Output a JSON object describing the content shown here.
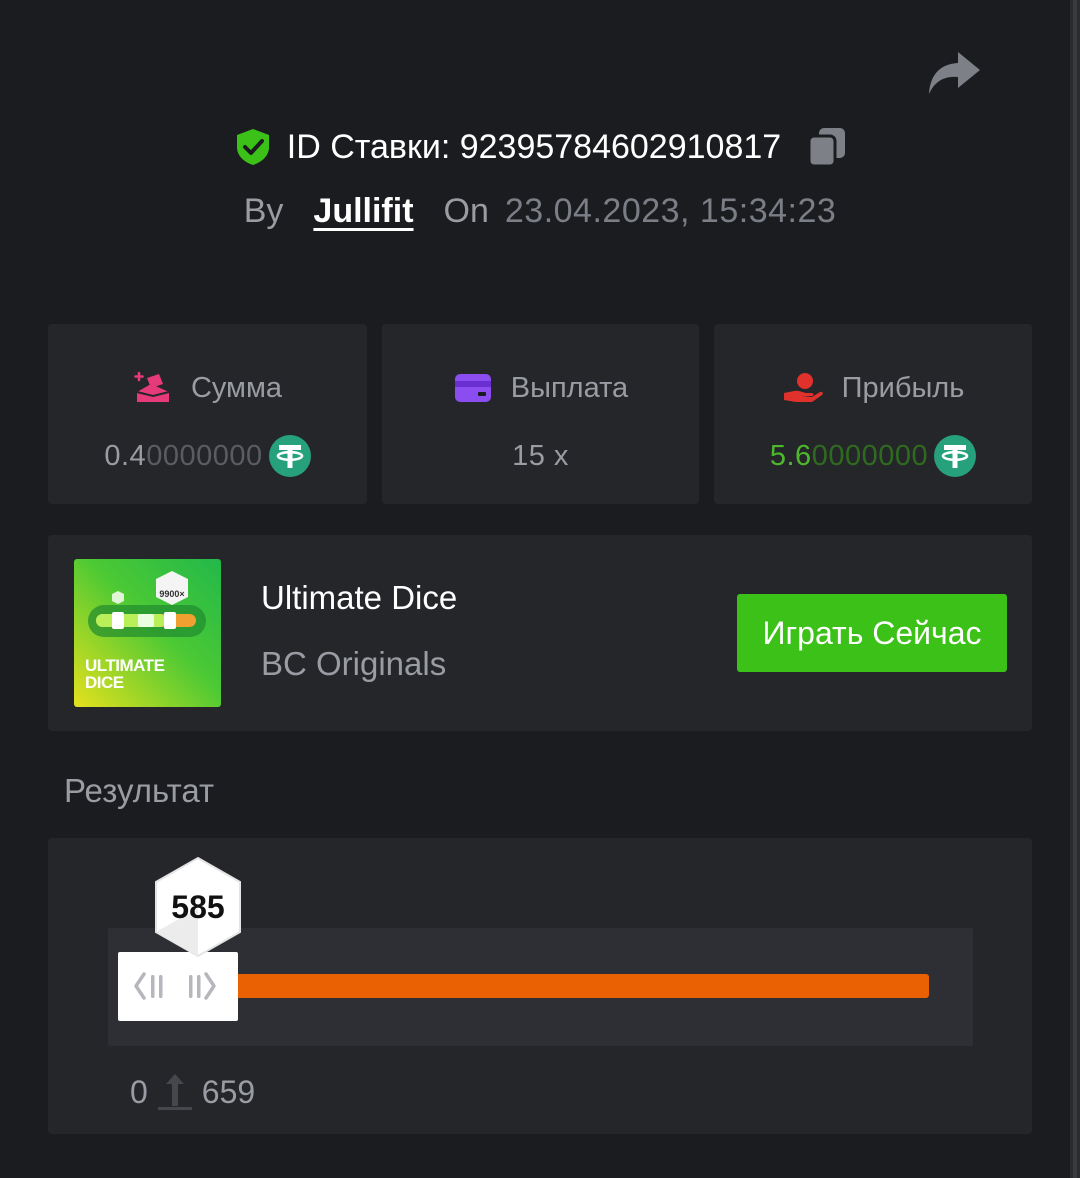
{
  "header": {
    "share_icon": "share-arrow-icon",
    "verified_icon": "shield-check-icon",
    "bet_id_text": "ID Ставки: 923957846029​10817",
    "copy_icon": "copy-icon",
    "by_label": "By",
    "username": "Jullifit",
    "on_label": "On",
    "datetime": "23.04.2023, 15:34:23"
  },
  "stats": [
    {
      "label": "Сумма",
      "icon": "bet-amount-icon",
      "value_main": "0.4",
      "value_dim": "0000000",
      "currency_icon": "usdt-icon"
    },
    {
      "label": "Выплата",
      "icon": "card-icon",
      "value": "15 x"
    },
    {
      "label": "Прибыль",
      "icon": "profit-hand-icon",
      "value_main": "5.6",
      "value_dim": "0000000",
      "currency_icon": "usdt-icon"
    }
  ],
  "game": {
    "thumb_multiplier": "9900×",
    "thumb_title_1": "ULTIMATE",
    "thumb_title_2": "DICE",
    "title": "Ultimate Dice",
    "provider": "BC Originals",
    "play_label": "Играть Сейчас"
  },
  "result": {
    "label": "Результат",
    "value": "585",
    "range_from": "0",
    "range_to": "659",
    "range_icon": "arrow-up-icon",
    "range_max_fraction": 0.659
  },
  "colors": {
    "background": "#1b1c1f",
    "card": "#25262a",
    "accent_green": "#3bc117",
    "profit_green": "#4eb82c",
    "bar_orange": "#ea6103",
    "usdt": "#26a17b"
  }
}
